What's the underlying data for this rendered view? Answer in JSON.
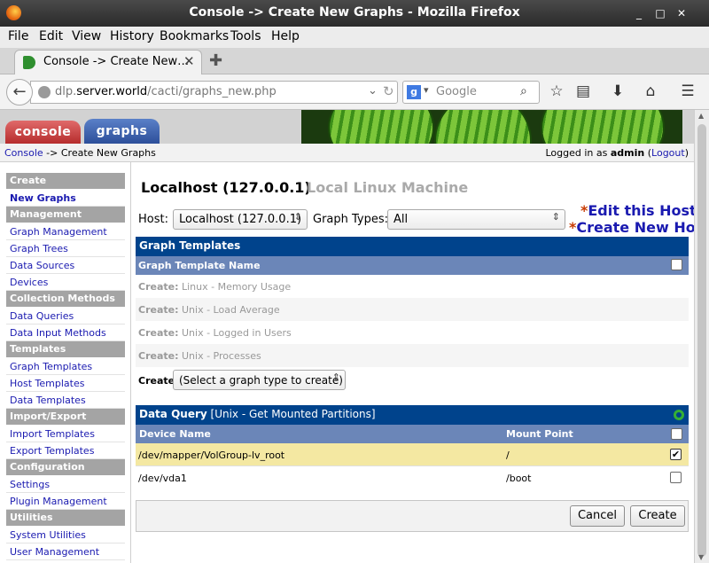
{
  "window": {
    "title": "Console -> Create New Graphs - Mozilla Firefox"
  },
  "menu": [
    "File",
    "Edit",
    "View",
    "History",
    "Bookmarks",
    "Tools",
    "Help"
  ],
  "tab": {
    "label": "Console -> Create New…"
  },
  "address": {
    "url_grey": "dlp.",
    "url_host": "server.world",
    "url_path": "/cacti/graphs_new.php"
  },
  "search": {
    "placeholder": "Google"
  },
  "cacti": {
    "tabs": {
      "console": "console",
      "graphs": "graphs"
    },
    "breadcrumb": {
      "console": "Console",
      "sep": " -> ",
      "current": "Create New Graphs"
    },
    "login": {
      "prefix": "Logged in as ",
      "user": "admin",
      "open": " (",
      "logout": "Logout",
      "close": ")"
    }
  },
  "sidebar": [
    {
      "type": "header",
      "label": "Create"
    },
    {
      "type": "item",
      "label": "New Graphs",
      "active": true
    },
    {
      "type": "header",
      "label": "Management"
    },
    {
      "type": "item",
      "label": "Graph Management"
    },
    {
      "type": "item",
      "label": "Graph Trees"
    },
    {
      "type": "item",
      "label": "Data Sources"
    },
    {
      "type": "item",
      "label": "Devices"
    },
    {
      "type": "header",
      "label": "Collection Methods"
    },
    {
      "type": "item",
      "label": "Data Queries"
    },
    {
      "type": "item",
      "label": "Data Input Methods"
    },
    {
      "type": "header",
      "label": "Templates"
    },
    {
      "type": "item",
      "label": "Graph Templates"
    },
    {
      "type": "item",
      "label": "Host Templates"
    },
    {
      "type": "item",
      "label": "Data Templates"
    },
    {
      "type": "header",
      "label": "Import/Export"
    },
    {
      "type": "item",
      "label": "Import Templates"
    },
    {
      "type": "item",
      "label": "Export Templates"
    },
    {
      "type": "header",
      "label": "Configuration"
    },
    {
      "type": "item",
      "label": "Settings"
    },
    {
      "type": "item",
      "label": "Plugin Management"
    },
    {
      "type": "header",
      "label": "Utilities"
    },
    {
      "type": "item",
      "label": "System Utilities"
    },
    {
      "type": "item",
      "label": "User Management"
    }
  ],
  "main": {
    "host_title": "Localhost (127.0.0.1)",
    "host_desc": "Local Linux Machine",
    "host_label": "Host:",
    "host_value": "Localhost (127.0.0.1)",
    "graph_types_label": "Graph Types:",
    "graph_types_value": "All",
    "edit_host": "Edit this Host",
    "create_host": "Create New Host",
    "star": "*",
    "graph_templates_header": "Graph Templates",
    "graph_template_name_col": "Graph Template Name",
    "create_prefix": "Create:",
    "templates": [
      "Linux - Memory Usage",
      "Unix - Load Average",
      "Unix - Logged in Users",
      "Unix - Processes"
    ],
    "create_label": "Create:",
    "create_select": "(Select a graph type to create)",
    "dq_label": "Data Query",
    "dq_name": "[Unix - Get Mounted Partitions]",
    "dq_col_device": "Device Name",
    "dq_col_mount": "Mount Point",
    "dq_rows": [
      {
        "device": "/dev/mapper/VolGroup-lv_root",
        "mount": "/",
        "checked": true
      },
      {
        "device": "/dev/vda1",
        "mount": "/boot",
        "checked": false
      }
    ],
    "cancel": "Cancel",
    "create": "Create"
  },
  "colors": {
    "header_blue": "#00438c",
    "subheader_blue": "#6b86b8",
    "row_highlight": "#f4e8a2",
    "link": "#1a1ab0"
  }
}
